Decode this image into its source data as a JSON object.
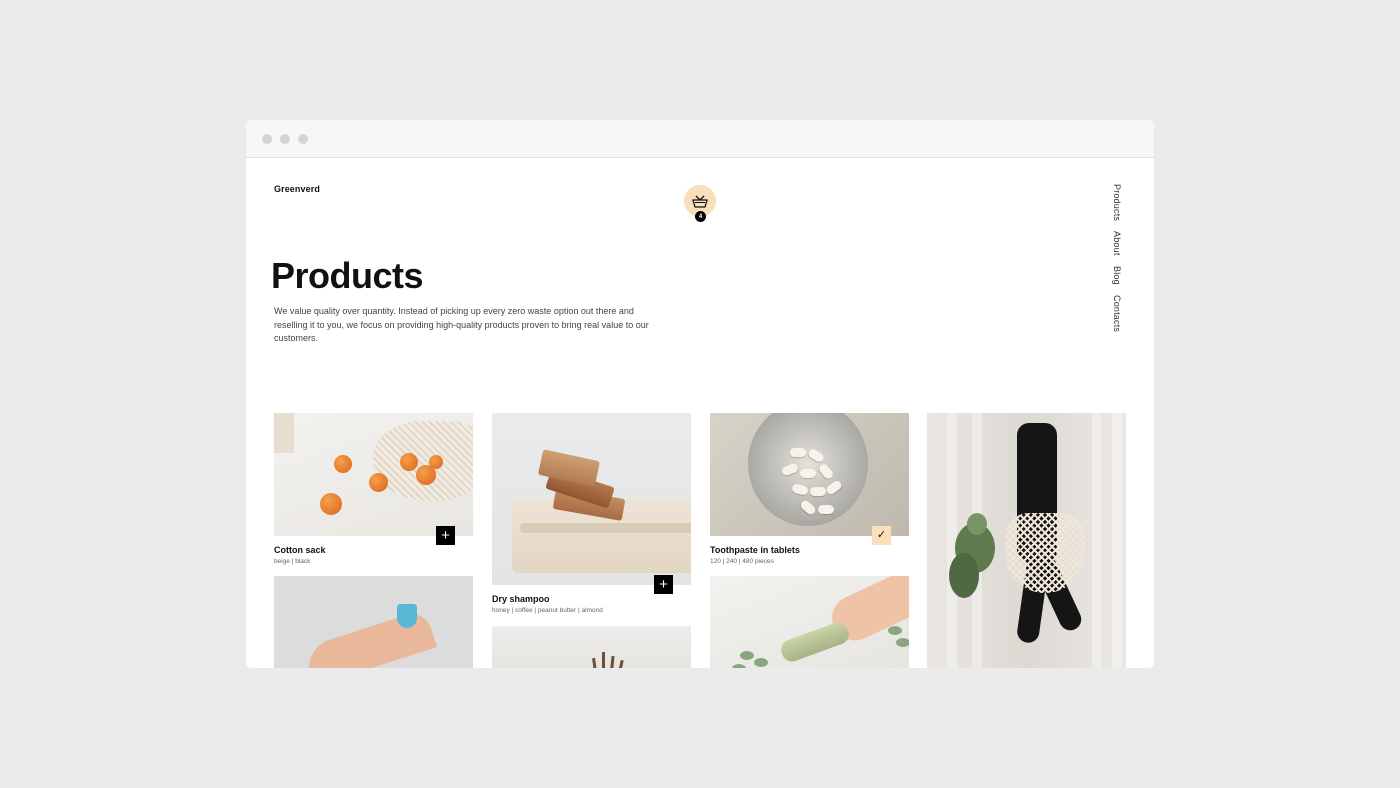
{
  "brand": "Greenverd",
  "cart": {
    "count": "4",
    "icon": "basket-icon",
    "accent": "#f9dfba"
  },
  "nav": [
    "Products",
    "About",
    "Blog",
    "Contacts"
  ],
  "heading": "Products",
  "intro": "We value quality over quantity. Instead of picking up every zero waste option out there and reselling it to you, we focus on providing high-quality products proven to bring real value to our customers.",
  "products": [
    {
      "title": "Cotton sack",
      "variants": "beige | black",
      "action": "+",
      "added": false
    },
    {
      "title": "Dry shampoo",
      "variants": "honey | coffee | peanut butter | almond",
      "action": "+",
      "added": false
    },
    {
      "title": "Toothpaste in tablets",
      "variants": "120 | 240 | 480 pieces",
      "action": "✓",
      "added": true
    }
  ]
}
